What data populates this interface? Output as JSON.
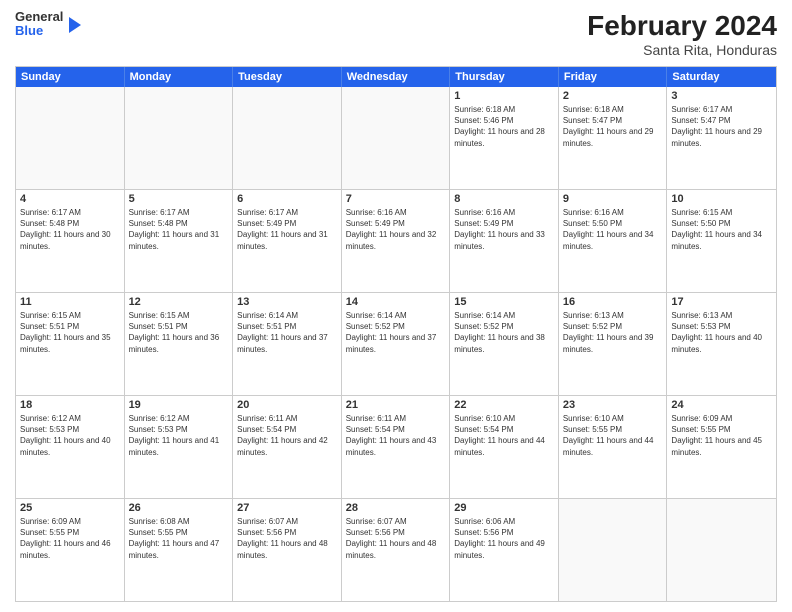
{
  "header": {
    "logo": {
      "line1": "General",
      "line2": "Blue"
    },
    "title": "February 2024",
    "subtitle": "Santa Rita, Honduras"
  },
  "weekdays": [
    "Sunday",
    "Monday",
    "Tuesday",
    "Wednesday",
    "Thursday",
    "Friday",
    "Saturday"
  ],
  "rows": [
    [
      {
        "day": "",
        "empty": true
      },
      {
        "day": "",
        "empty": true
      },
      {
        "day": "",
        "empty": true
      },
      {
        "day": "",
        "empty": true
      },
      {
        "day": "1",
        "sunrise": "6:18 AM",
        "sunset": "5:46 PM",
        "daylight": "11 hours and 28 minutes."
      },
      {
        "day": "2",
        "sunrise": "6:18 AM",
        "sunset": "5:47 PM",
        "daylight": "11 hours and 29 minutes."
      },
      {
        "day": "3",
        "sunrise": "6:17 AM",
        "sunset": "5:47 PM",
        "daylight": "11 hours and 29 minutes."
      }
    ],
    [
      {
        "day": "4",
        "sunrise": "6:17 AM",
        "sunset": "5:48 PM",
        "daylight": "11 hours and 30 minutes."
      },
      {
        "day": "5",
        "sunrise": "6:17 AM",
        "sunset": "5:48 PM",
        "daylight": "11 hours and 31 minutes."
      },
      {
        "day": "6",
        "sunrise": "6:17 AM",
        "sunset": "5:49 PM",
        "daylight": "11 hours and 31 minutes."
      },
      {
        "day": "7",
        "sunrise": "6:16 AM",
        "sunset": "5:49 PM",
        "daylight": "11 hours and 32 minutes."
      },
      {
        "day": "8",
        "sunrise": "6:16 AM",
        "sunset": "5:49 PM",
        "daylight": "11 hours and 33 minutes."
      },
      {
        "day": "9",
        "sunrise": "6:16 AM",
        "sunset": "5:50 PM",
        "daylight": "11 hours and 34 minutes."
      },
      {
        "day": "10",
        "sunrise": "6:15 AM",
        "sunset": "5:50 PM",
        "daylight": "11 hours and 34 minutes."
      }
    ],
    [
      {
        "day": "11",
        "sunrise": "6:15 AM",
        "sunset": "5:51 PM",
        "daylight": "11 hours and 35 minutes."
      },
      {
        "day": "12",
        "sunrise": "6:15 AM",
        "sunset": "5:51 PM",
        "daylight": "11 hours and 36 minutes."
      },
      {
        "day": "13",
        "sunrise": "6:14 AM",
        "sunset": "5:51 PM",
        "daylight": "11 hours and 37 minutes."
      },
      {
        "day": "14",
        "sunrise": "6:14 AM",
        "sunset": "5:52 PM",
        "daylight": "11 hours and 37 minutes."
      },
      {
        "day": "15",
        "sunrise": "6:14 AM",
        "sunset": "5:52 PM",
        "daylight": "11 hours and 38 minutes."
      },
      {
        "day": "16",
        "sunrise": "6:13 AM",
        "sunset": "5:52 PM",
        "daylight": "11 hours and 39 minutes."
      },
      {
        "day": "17",
        "sunrise": "6:13 AM",
        "sunset": "5:53 PM",
        "daylight": "11 hours and 40 minutes."
      }
    ],
    [
      {
        "day": "18",
        "sunrise": "6:12 AM",
        "sunset": "5:53 PM",
        "daylight": "11 hours and 40 minutes."
      },
      {
        "day": "19",
        "sunrise": "6:12 AM",
        "sunset": "5:53 PM",
        "daylight": "11 hours and 41 minutes."
      },
      {
        "day": "20",
        "sunrise": "6:11 AM",
        "sunset": "5:54 PM",
        "daylight": "11 hours and 42 minutes."
      },
      {
        "day": "21",
        "sunrise": "6:11 AM",
        "sunset": "5:54 PM",
        "daylight": "11 hours and 43 minutes."
      },
      {
        "day": "22",
        "sunrise": "6:10 AM",
        "sunset": "5:54 PM",
        "daylight": "11 hours and 44 minutes."
      },
      {
        "day": "23",
        "sunrise": "6:10 AM",
        "sunset": "5:55 PM",
        "daylight": "11 hours and 44 minutes."
      },
      {
        "day": "24",
        "sunrise": "6:09 AM",
        "sunset": "5:55 PM",
        "daylight": "11 hours and 45 minutes."
      }
    ],
    [
      {
        "day": "25",
        "sunrise": "6:09 AM",
        "sunset": "5:55 PM",
        "daylight": "11 hours and 46 minutes."
      },
      {
        "day": "26",
        "sunrise": "6:08 AM",
        "sunset": "5:55 PM",
        "daylight": "11 hours and 47 minutes."
      },
      {
        "day": "27",
        "sunrise": "6:07 AM",
        "sunset": "5:56 PM",
        "daylight": "11 hours and 48 minutes."
      },
      {
        "day": "28",
        "sunrise": "6:07 AM",
        "sunset": "5:56 PM",
        "daylight": "11 hours and 48 minutes."
      },
      {
        "day": "29",
        "sunrise": "6:06 AM",
        "sunset": "5:56 PM",
        "daylight": "11 hours and 49 minutes."
      },
      {
        "day": "",
        "empty": true
      },
      {
        "day": "",
        "empty": true
      }
    ]
  ]
}
